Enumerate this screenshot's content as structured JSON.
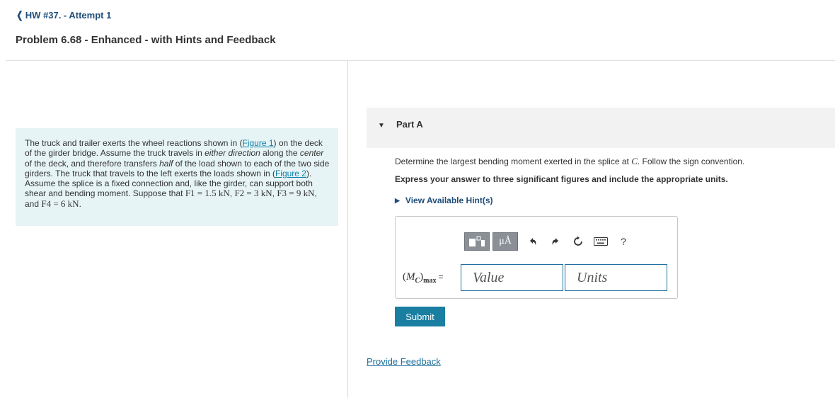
{
  "nav": {
    "back_label": "HW #37. - Attempt 1",
    "back_icon": "chevron-left-icon"
  },
  "problem": {
    "title": "Problem 6.68 - Enhanced - with Hints and Feedback",
    "text": {
      "s1": "The truck and trailer exerts the wheel reactions shown in (",
      "figure1": "Figure 1",
      "s2": ") on the deck of the girder bridge. Assume the truck travels in ",
      "em1": "either direction",
      "s3": " along the ",
      "em2": "center",
      "s4": " of the deck, and therefore transfers ",
      "em3": "half",
      "s5": " of the load shown to each of the two side girders. The truck that travels to the left exerts the loads shown in (",
      "figure2": "Figure 2",
      "s6": "). Assume the splice is a fixed connection and, like the girder, can support both shear and bending moment. Suppose that ",
      "f1": "F1 = 1.5 kN",
      "f2": "F2 = 3 kN",
      "f3": "F3 = 9 kN",
      "and": "and",
      "f4": "F4 = 6 kN"
    }
  },
  "part": {
    "label": "Part A",
    "question_prefix": "Determine the largest bending moment exerted in the splice at ",
    "question_var": "C",
    "question_suffix": ". Follow the sign convention.",
    "instructions": "Express your answer to three significant figures and include the appropriate units.",
    "hints_label": "View Available Hint(s)"
  },
  "answer": {
    "toolbar": {
      "templates_icon": "templates-icon",
      "units_label": "μÅ",
      "undo_icon": "undo-icon",
      "redo_icon": "redo-icon",
      "reset_icon": "reset-icon",
      "keyboard_icon": "keyboard-icon",
      "help_label": "?"
    },
    "variable": "(MC)max",
    "equals": "=",
    "value_placeholder": "Value",
    "units_placeholder": "Units"
  },
  "submit_label": "Submit",
  "feedback_label": "Provide Feedback"
}
